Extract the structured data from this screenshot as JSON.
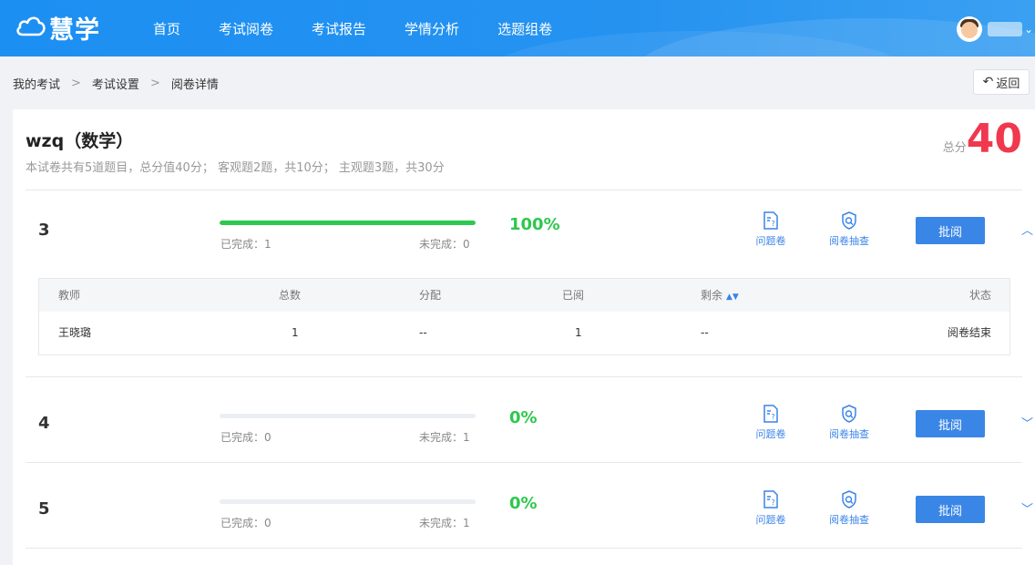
{
  "header": {
    "logo_text": "慧学",
    "nav": [
      "首页",
      "考试阅卷",
      "考试报告",
      "学情分析",
      "选题组卷"
    ],
    "accent": "#1c8ff3"
  },
  "breadcrumb": [
    "我的考试",
    "考试设置",
    "阅卷详情"
  ],
  "back_label": "返回",
  "exam": {
    "title": "wzq（数学）",
    "description": "本试卷共有5道题目，总分值40分；  客观题2题，共10分；  主观题3题，共30分",
    "total_label": "总分",
    "total_value": "40"
  },
  "questions": [
    {
      "num": "3",
      "progress": 1.0,
      "done": "已完成：1",
      "undone": "未完成：0",
      "percent": "100%",
      "expanded": true
    },
    {
      "num": "4",
      "progress": 0.0,
      "done": "已完成：0",
      "undone": "未完成：1",
      "percent": "0%",
      "expanded": false
    },
    {
      "num": "5",
      "progress": 0.0,
      "done": "已完成：0",
      "undone": "未完成：1",
      "percent": "0%",
      "expanded": false
    }
  ],
  "actions": {
    "problem_paper": "问题卷",
    "spot_check": "阅卷抽查",
    "mark": "批阅"
  },
  "table": {
    "headers": [
      "教师",
      "总数",
      "分配",
      "已阅",
      "剩余",
      "状态"
    ],
    "rows": [
      [
        "王晓璐",
        "1",
        "--",
        "1",
        "--",
        "阅卷结束"
      ]
    ]
  },
  "icons": [
    "cloud-logo-icon",
    "avatar",
    "chevron-down-icon",
    "back-arrow-icon",
    "problem-paper-icon",
    "spot-check-icon",
    "chevron-up-icon",
    "sort-icon"
  ]
}
